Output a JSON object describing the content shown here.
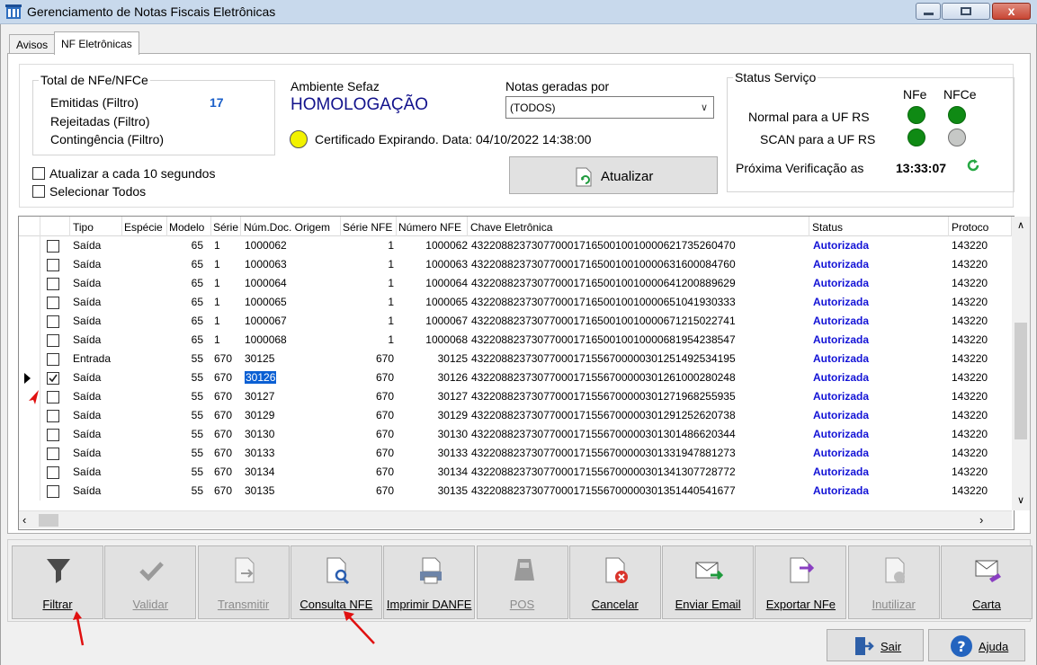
{
  "window": {
    "title": "Gerenciamento de Notas Fiscais Eletrônicas",
    "close_glyph": "x"
  },
  "tabs": [
    {
      "label": "Avisos"
    },
    {
      "label": "NF Eletrônicas"
    }
  ],
  "totals": {
    "title": "Total de NFe/NFCe",
    "emitidas_label": "Emitidas (Filtro)",
    "emitidas_value": "17",
    "rejeitadas_label": "Rejeitadas (Filtro)",
    "contingencia_label": "Contingência (Filtro)"
  },
  "ambiente": {
    "label": "Ambiente Sefaz",
    "value": "HOMOLOGAÇÃO"
  },
  "notas": {
    "label": "Notas geradas por",
    "selected": "(TODOS)"
  },
  "certificado": {
    "text": "Certificado Expirando. Data: 04/10/2022 14:38:00",
    "indicator_color": "#f2f200"
  },
  "options": {
    "auto_refresh": "Atualizar a cada 10 segundos",
    "select_all": "Selecionar Todos"
  },
  "atualizar_label": "Atualizar",
  "status_servico": {
    "title": "Status Serviço",
    "col_nfe": "NFe",
    "col_nfce": "NFCe",
    "row1": "Normal para a UF RS",
    "row2": "SCAN para a UF RS",
    "next_label": "Próxima Verificação as",
    "next_time": "13:33:07"
  },
  "grid": {
    "headers": [
      "Tipo",
      "Espécie",
      "Modelo",
      "Série",
      "Núm.Doc. Origem",
      "Série NFE",
      "Número NFE",
      "Chave Eletrônica",
      "Status",
      "Protoco"
    ],
    "rows": [
      {
        "tipo": "Saída",
        "modelo": "65",
        "serie": "1",
        "doc": "1000062",
        "serie_nfe": "1",
        "numero": "1000062",
        "chave": "43220882373077000171650010010000621735260470",
        "status": "Autorizada",
        "protocolo": "143220",
        "checked": false
      },
      {
        "tipo": "Saída",
        "modelo": "65",
        "serie": "1",
        "doc": "1000063",
        "serie_nfe": "1",
        "numero": "1000063",
        "chave": "43220882373077000171650010010000631600084760",
        "status": "Autorizada",
        "protocolo": "143220",
        "checked": false
      },
      {
        "tipo": "Saída",
        "modelo": "65",
        "serie": "1",
        "doc": "1000064",
        "serie_nfe": "1",
        "numero": "1000064",
        "chave": "43220882373077000171650010010000641200889629",
        "status": "Autorizada",
        "protocolo": "143220",
        "checked": false
      },
      {
        "tipo": "Saída",
        "modelo": "65",
        "serie": "1",
        "doc": "1000065",
        "serie_nfe": "1",
        "numero": "1000065",
        "chave": "43220882373077000171650010010000651041930333",
        "status": "Autorizada",
        "protocolo": "143220",
        "checked": false
      },
      {
        "tipo": "Saída",
        "modelo": "65",
        "serie": "1",
        "doc": "1000067",
        "serie_nfe": "1",
        "numero": "1000067",
        "chave": "43220882373077000171650010010000671215022741",
        "status": "Autorizada",
        "protocolo": "143220",
        "checked": false
      },
      {
        "tipo": "Saída",
        "modelo": "65",
        "serie": "1",
        "doc": "1000068",
        "serie_nfe": "1",
        "numero": "1000068",
        "chave": "43220882373077000171650010010000681954238547",
        "status": "Autorizada",
        "protocolo": "143220",
        "checked": false
      },
      {
        "tipo": "Entrada",
        "modelo": "55",
        "serie": "670",
        "doc": "30125",
        "serie_nfe": "670",
        "numero": "30125",
        "chave": "43220882373077000171556700000301251492534195",
        "status": "Autorizada",
        "protocolo": "143220",
        "checked": false
      },
      {
        "tipo": "Saída",
        "modelo": "55",
        "serie": "670",
        "doc": "30126",
        "serie_nfe": "670",
        "numero": "30126",
        "chave": "43220882373077000171556700000301261000280248",
        "status": "Autorizada",
        "protocolo": "143220",
        "checked": true
      },
      {
        "tipo": "Saída",
        "modelo": "55",
        "serie": "670",
        "doc": "30127",
        "serie_nfe": "670",
        "numero": "30127",
        "chave": "43220882373077000171556700000301271968255935",
        "status": "Autorizada",
        "protocolo": "143220",
        "checked": false
      },
      {
        "tipo": "Saída",
        "modelo": "55",
        "serie": "670",
        "doc": "30129",
        "serie_nfe": "670",
        "numero": "30129",
        "chave": "43220882373077000171556700000301291252620738",
        "status": "Autorizada",
        "protocolo": "143220",
        "checked": false
      },
      {
        "tipo": "Saída",
        "modelo": "55",
        "serie": "670",
        "doc": "30130",
        "serie_nfe": "670",
        "numero": "30130",
        "chave": "43220882373077000171556700000301301486620344",
        "status": "Autorizada",
        "protocolo": "143220",
        "checked": false
      },
      {
        "tipo": "Saída",
        "modelo": "55",
        "serie": "670",
        "doc": "30133",
        "serie_nfe": "670",
        "numero": "30133",
        "chave": "43220882373077000171556700000301331947881273",
        "status": "Autorizada",
        "protocolo": "143220",
        "checked": false
      },
      {
        "tipo": "Saída",
        "modelo": "55",
        "serie": "670",
        "doc": "30134",
        "serie_nfe": "670",
        "numero": "30134",
        "chave": "43220882373077000171556700000301341307728772",
        "status": "Autorizada",
        "protocolo": "143220",
        "checked": false
      },
      {
        "tipo": "Saída",
        "modelo": "55",
        "serie": "670",
        "doc": "30135",
        "serie_nfe": "670",
        "numero": "30135",
        "chave": "43220882373077000171556700000301351440541677",
        "status": "Autorizada",
        "protocolo": "143220",
        "checked": false
      }
    ]
  },
  "toolbar": [
    {
      "label": "Filtrar",
      "icon": "filter-icon",
      "enabled": true
    },
    {
      "label": "Validar",
      "icon": "check-icon",
      "enabled": false
    },
    {
      "label": "Transmitir",
      "icon": "transmit-document-icon",
      "enabled": false
    },
    {
      "label": "Consulta NFE",
      "icon": "search-document-icon",
      "enabled": true
    },
    {
      "label": "Imprimir DANFE",
      "icon": "print-document-icon",
      "enabled": true
    },
    {
      "label": "POS",
      "icon": "pos-terminal-icon",
      "enabled": false
    },
    {
      "label": "Cancelar",
      "icon": "cancel-document-icon",
      "enabled": true
    },
    {
      "label": "Enviar Email",
      "icon": "send-email-icon",
      "enabled": true
    },
    {
      "label": "Exportar NFe",
      "icon": "export-document-icon",
      "enabled": true
    },
    {
      "label": "Inutilizar",
      "icon": "void-document-icon",
      "enabled": false
    },
    {
      "label": "Carta",
      "icon": "letter-icon",
      "enabled": true
    }
  ],
  "footer": {
    "sair": "Sair",
    "ajuda": "Ajuda"
  }
}
